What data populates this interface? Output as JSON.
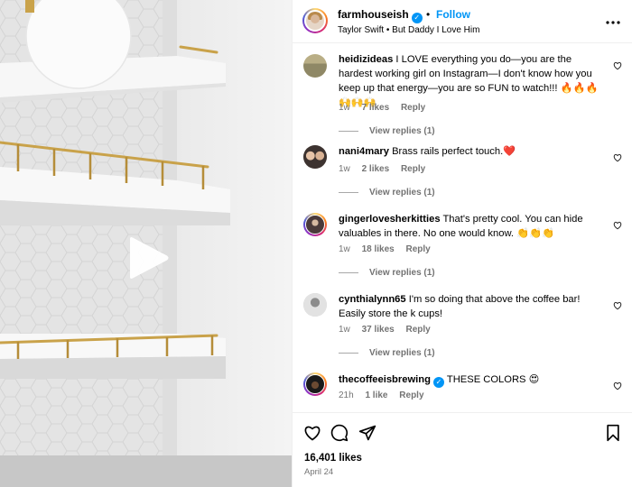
{
  "post": {
    "username": "farmhouseish",
    "follow_label": "Follow",
    "separator": "•",
    "audio": "Taylor Swift • But Daddy I Love Him",
    "likes": "16,401 likes",
    "date": "April 24"
  },
  "comments": [
    {
      "username": "heidizideas",
      "text": "I LOVE everything you do—you are the hardest working girl on Instagram—I don't know how you keep up that energy—you are so FUN to watch!!! 🔥🔥🔥🙌🙌🙌",
      "time": "1w",
      "likes": "7 likes",
      "reply": "Reply",
      "view_replies": "View replies (1)"
    },
    {
      "username": "nani4mary",
      "text": "Brass rails perfect touch.❤️",
      "time": "1w",
      "likes": "2 likes",
      "reply": "Reply",
      "view_replies": "View replies (1)"
    },
    {
      "username": "gingerlovesherkitties",
      "text": "That's pretty cool. You can hide valuables in there. No one would know. 👏👏👏",
      "time": "1w",
      "likes": "18 likes",
      "reply": "Reply",
      "view_replies": "View replies (1)"
    },
    {
      "username": "cynthialynn65",
      "text": "I'm so doing that above the coffee bar! Easily store the k cups!",
      "time": "1w",
      "likes": "37 likes",
      "reply": "Reply",
      "view_replies": "View replies (1)"
    },
    {
      "username": "thecoffeeisbrewing",
      "text": "THESE COLORS 😍",
      "time": "21h",
      "likes": "1 like",
      "reply": "Reply"
    }
  ],
  "icons": {
    "verified": "verified-badge-icon",
    "more": "more-options-icon",
    "play": "play-icon",
    "heart": "heart-icon",
    "comment": "comment-icon",
    "share": "share-icon",
    "save": "bookmark-icon"
  },
  "colors": {
    "accent": "#0095f6",
    "muted": "#737373",
    "border": "#efefef",
    "brass": "#c9a24a"
  }
}
